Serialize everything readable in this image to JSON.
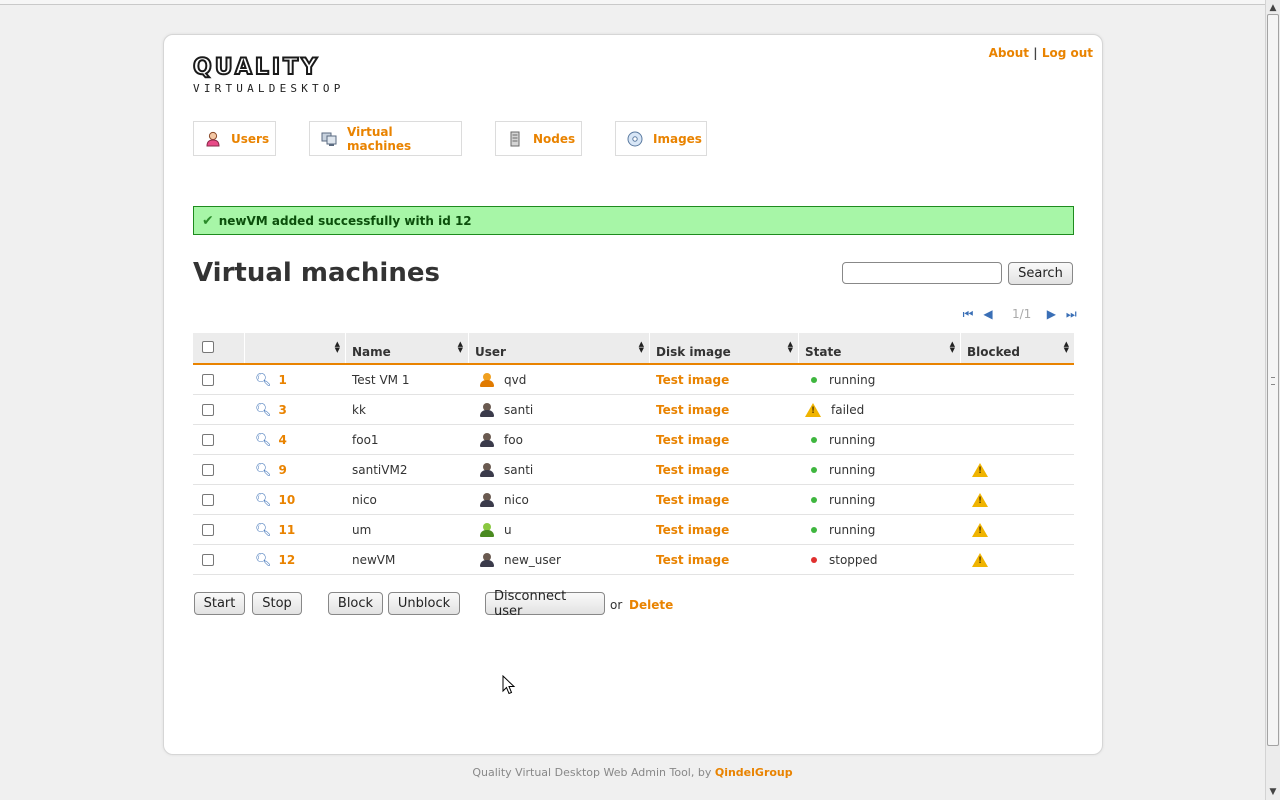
{
  "logo": {
    "word": "QUALITY",
    "sub": "VIRTUALDESKTOP"
  },
  "toplinks": {
    "about": "About",
    "sep": "|",
    "logout": "Log out"
  },
  "nav": [
    {
      "label": "Users",
      "icon": "user-icon"
    },
    {
      "label": "Virtual machines",
      "icon": "computer-icon"
    },
    {
      "label": "Nodes",
      "icon": "server-icon"
    },
    {
      "label": "Images",
      "icon": "disc-icon"
    }
  ],
  "flash": {
    "message": "newVM added successfully with id 12",
    "icon": "checkmark-icon"
  },
  "page": {
    "title": "Virtual machines"
  },
  "search": {
    "value": "",
    "button": "Search"
  },
  "pager": {
    "pages": "1/1"
  },
  "table": {
    "headers": [
      "",
      "Name",
      "User",
      "Disk image",
      "State",
      "Blocked"
    ],
    "rows": [
      {
        "id": "1",
        "name": "Test VM 1",
        "user": "qvd",
        "user_color": "orange",
        "disk": "Test image",
        "state": "running",
        "state_icon": "green-dot",
        "blocked": false
      },
      {
        "id": "3",
        "name": "kk",
        "user": "santi",
        "user_color": "dark",
        "disk": "Test image",
        "state": "failed",
        "state_icon": "warning-icon",
        "blocked": false
      },
      {
        "id": "4",
        "name": "foo1",
        "user": "foo",
        "user_color": "dark",
        "disk": "Test image",
        "state": "running",
        "state_icon": "green-dot",
        "blocked": false
      },
      {
        "id": "9",
        "name": "santiVM2",
        "user": "santi",
        "user_color": "dark",
        "disk": "Test image",
        "state": "running",
        "state_icon": "green-dot",
        "blocked": true
      },
      {
        "id": "10",
        "name": "nico",
        "user": "nico",
        "user_color": "dark",
        "disk": "Test image",
        "state": "running",
        "state_icon": "green-dot",
        "blocked": true
      },
      {
        "id": "11",
        "name": "um",
        "user": "u",
        "user_color": "green",
        "disk": "Test image",
        "state": "running",
        "state_icon": "green-dot",
        "blocked": true
      },
      {
        "id": "12",
        "name": "newVM",
        "user": "new_user",
        "user_color": "dark",
        "disk": "Test image",
        "state": "stopped",
        "state_icon": "red-dot",
        "blocked": true
      }
    ]
  },
  "actions": {
    "start": "Start",
    "stop": "Stop",
    "block": "Block",
    "unblock": "Unblock",
    "disconnect": "Disconnect user",
    "or": "or",
    "delete": "Delete"
  },
  "footer": {
    "text": "Quality Virtual Desktop Web Admin Tool, by",
    "brand": "QindelGroup"
  },
  "colors": {
    "accent": "#e98300",
    "flash_bg": "#a7f6a7",
    "flash_border": "#1e8b1e",
    "running": "#3fb63f",
    "stopped": "#e0302f"
  }
}
